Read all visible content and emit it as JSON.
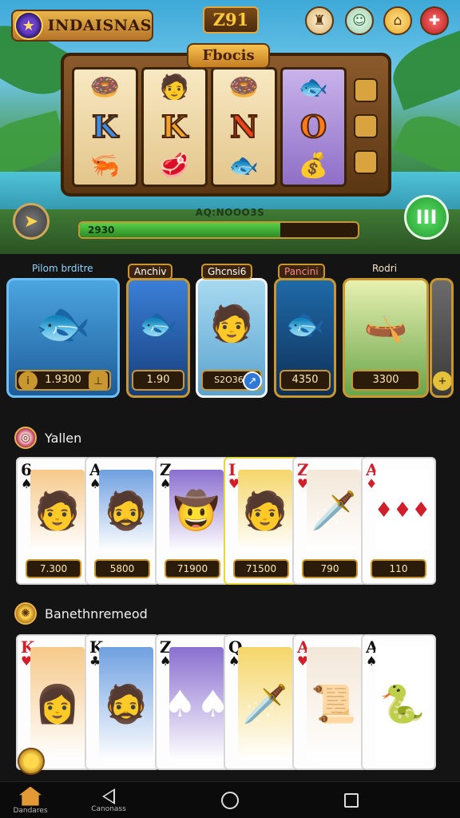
{
  "header": {
    "brand": "INDAISNAS",
    "coins": "Z91",
    "buttons": [
      "trophy-icon",
      "profile-icon",
      "home-icon",
      "gift-icon"
    ]
  },
  "slot": {
    "title": "Fbocis",
    "reels": [
      [
        "🍩",
        "K",
        "🦐"
      ],
      [
        "🧑",
        "K",
        "🥩"
      ],
      [
        "🍩",
        "N",
        "🐟"
      ],
      [
        "🐟",
        "O",
        "💰"
      ]
    ],
    "jackpot_label": "AQ:NOOO3S",
    "progress_text": "2930",
    "progress_fraction": 0.72
  },
  "features": [
    {
      "label": "Pilom brditre",
      "price": "1.9300",
      "art": "🐟"
    },
    {
      "label": "Anchiv",
      "price": "1.90",
      "art": "🐟"
    },
    {
      "label": "Ghcnsi6",
      "price": "S2O361",
      "art": "🧑"
    },
    {
      "label": "Pancini",
      "price": "4350",
      "art": "🐟"
    },
    {
      "label": "Rodri",
      "price": "3300",
      "art": "🛶"
    }
  ],
  "sections": {
    "first": "Yallen",
    "second": "Banethnremeod"
  },
  "cards_row1": [
    {
      "rank": "6",
      "suit": "♠",
      "color": "black",
      "price": "7.300",
      "art": "🧑"
    },
    {
      "rank": "A",
      "suit": "♠",
      "color": "black",
      "price": "5800",
      "art": "🧔"
    },
    {
      "rank": "Z",
      "suit": "♠",
      "color": "black",
      "price": "71900",
      "art": "🤠"
    },
    {
      "rank": "I",
      "suit": "♥",
      "color": "red",
      "price": "71500",
      "art": "🧑"
    },
    {
      "rank": "Z",
      "suit": "♥",
      "color": "red",
      "price": "790",
      "art": "🗡️"
    },
    {
      "rank": "A",
      "suit": "♦",
      "color": "red",
      "price": "110",
      "art": "♦♦♦"
    }
  ],
  "cards_row2": [
    {
      "rank": "K",
      "suit": "♥",
      "color": "red",
      "art": "👩"
    },
    {
      "rank": "K",
      "suit": "♣",
      "color": "black",
      "art": "🧔"
    },
    {
      "rank": "Z",
      "suit": "♠",
      "color": "black",
      "art": "♠♠"
    },
    {
      "rank": "Q",
      "suit": "♠",
      "color": "black",
      "art": "🗡️"
    },
    {
      "rank": "A",
      "suit": "♥",
      "color": "red",
      "art": "📜"
    },
    {
      "rank": "A",
      "suit": "♠",
      "color": "black",
      "art": "🐍"
    }
  ],
  "nav": {
    "home_label": "Dandares",
    "back_label": "Canonass"
  }
}
